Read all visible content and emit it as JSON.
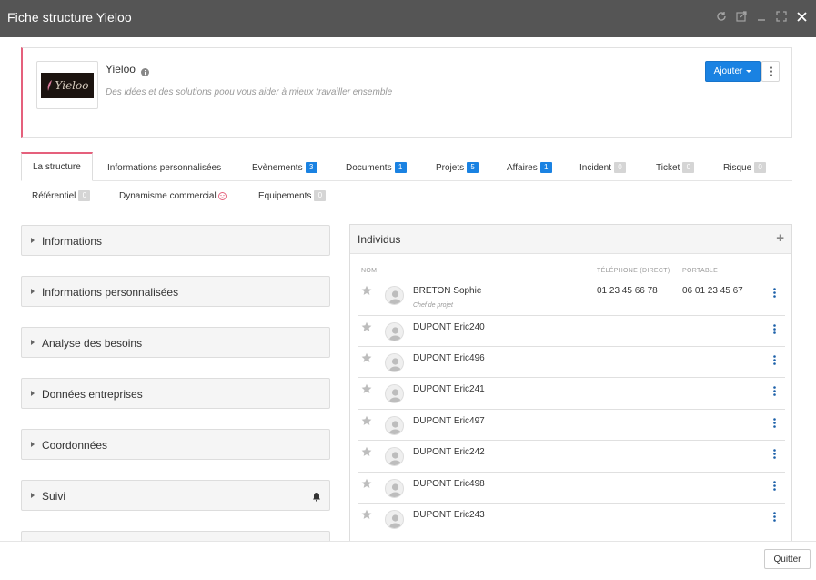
{
  "window": {
    "title": "Fiche structure Yieloo"
  },
  "company": {
    "logo_text": "Yieloo",
    "name": "Yieloo",
    "slogan": "Des idées et des solutions poou vous aider à mieux travailler ensemble",
    "add_button": "Ajouter"
  },
  "tabs": [
    {
      "label": "La structure",
      "badge": "",
      "badge_color": ""
    },
    {
      "label": "Informations personnalisées",
      "badge": "",
      "badge_color": ""
    },
    {
      "label": "Evènements",
      "badge": "3",
      "badge_color": "blue"
    },
    {
      "label": "Documents",
      "badge": "1",
      "badge_color": "blue"
    },
    {
      "label": "Projets",
      "badge": "5",
      "badge_color": "blue"
    },
    {
      "label": "Affaires",
      "badge": "1",
      "badge_color": "blue"
    },
    {
      "label": "Incident",
      "badge": "0",
      "badge_color": "grey"
    },
    {
      "label": "Ticket",
      "badge": "0",
      "badge_color": "grey"
    },
    {
      "label": "Risque",
      "badge": "0",
      "badge_color": "grey"
    },
    {
      "label": "Référentiel",
      "badge": "0",
      "badge_color": "grey"
    },
    {
      "label": "Dynamisme commercial",
      "badge": "",
      "badge_color": ""
    },
    {
      "label": "Equipements",
      "badge": "0",
      "badge_color": "grey"
    }
  ],
  "panels": [
    {
      "label": "Informations"
    },
    {
      "label": "Informations personnalisées"
    },
    {
      "label": "Analyse des besoins"
    },
    {
      "label": "Données entreprises"
    },
    {
      "label": "Coordonnées"
    },
    {
      "label": "Suivi"
    }
  ],
  "individus": {
    "title": "Individus",
    "columns": {
      "name": "NOM",
      "phone": "TÉLÉPHONE (DIRECT)",
      "mobile": "PORTABLE"
    },
    "rows": [
      {
        "name": "BRETON Sophie",
        "role": "Chef de projet",
        "phone": "01 23 45 66 78",
        "mobile": "06 01 23 45 67"
      },
      {
        "name": "DUPONT Eric240",
        "role": "",
        "phone": "",
        "mobile": ""
      },
      {
        "name": "DUPONT Eric496",
        "role": "",
        "phone": "",
        "mobile": ""
      },
      {
        "name": "DUPONT Eric241",
        "role": "",
        "phone": "",
        "mobile": ""
      },
      {
        "name": "DUPONT Eric497",
        "role": "",
        "phone": "",
        "mobile": ""
      },
      {
        "name": "DUPONT Eric242",
        "role": "",
        "phone": "",
        "mobile": ""
      },
      {
        "name": "DUPONT Eric498",
        "role": "",
        "phone": "",
        "mobile": ""
      },
      {
        "name": "DUPONT Eric243",
        "role": "",
        "phone": "",
        "mobile": ""
      }
    ]
  },
  "footer": {
    "quit_button": "Quitter"
  },
  "colors": {
    "titlebar": "#555555",
    "accent": "#e5607c",
    "primary": "#1a82e2",
    "badge_grey": "#d5d5d5"
  }
}
